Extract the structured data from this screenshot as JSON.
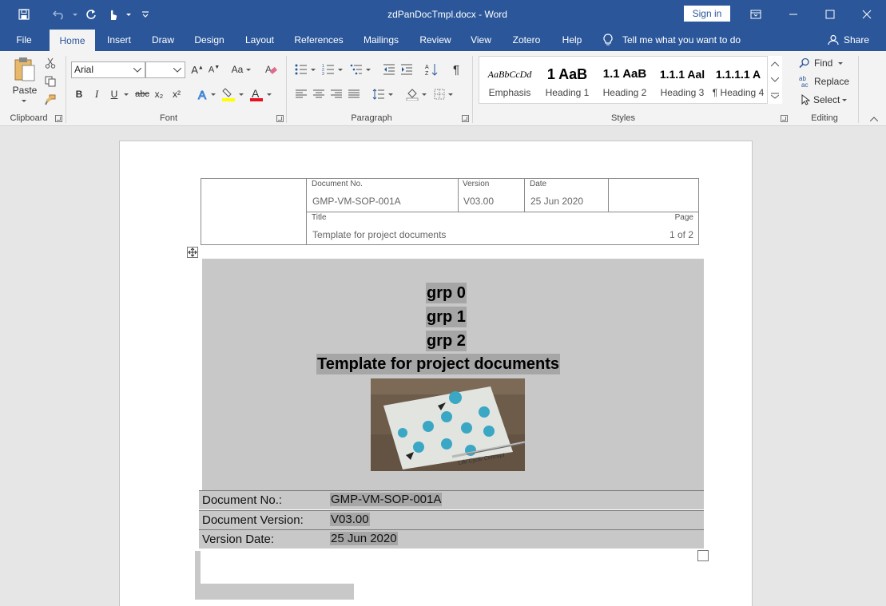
{
  "window": {
    "title": "zdPanDocTmpl.docx  -  Word",
    "sign_in": "Sign in"
  },
  "ribbon_tabs": [
    "File",
    "Home",
    "Insert",
    "Draw",
    "Design",
    "Layout",
    "References",
    "Mailings",
    "Review",
    "View",
    "Zotero",
    "Help"
  ],
  "tell_me": "Tell me what you want to do",
  "share": "Share",
  "clipboard": {
    "paste": "Paste",
    "label": "Clipboard"
  },
  "font": {
    "name": "Arial",
    "size": "",
    "label": "Font",
    "case_label": "Aa",
    "bold": "B",
    "italic": "I",
    "underline": "U",
    "strike": "abc",
    "sub": "x₂",
    "sup": "x²"
  },
  "paragraph": {
    "label": "Paragraph"
  },
  "styles": {
    "label": "Styles",
    "items": [
      {
        "sample": "AaBbCcDd",
        "name": "Emphasis"
      },
      {
        "sample": "1  AaB",
        "name": "Heading 1"
      },
      {
        "sample": "1.1  AaB",
        "name": "Heading 2"
      },
      {
        "sample": "1.1.1  Aal",
        "name": "Heading 3"
      },
      {
        "sample": "1.1.1.1  A",
        "name": "¶ Heading 4"
      }
    ]
  },
  "editing": {
    "label": "Editing",
    "find": "Find",
    "replace": "Replace",
    "select": "Select"
  },
  "header_table": {
    "doc_no_label": "Document No.",
    "doc_no": "GMP-VM-SOP-001A",
    "version_label": "Version",
    "version": "V03.00",
    "date_label": "Date",
    "date": "25 Jun 2020",
    "title_label": "Title",
    "title": "Template for project documents",
    "page_label": "Page",
    "page": "1 of 2"
  },
  "cover": {
    "grp0": "grp 0",
    "grp1": "grp 1",
    "grp2": "grp 2",
    "main_title": "Template for project documents",
    "photo_caption": "Life Cycle Concept"
  },
  "info_rows": [
    {
      "label": "Document No.:",
      "value": "GMP-VM-SOP-001A"
    },
    {
      "label": "Document Version:",
      "value": "V03.00"
    },
    {
      "label": "Version Date:",
      "value": "25 Jun 2020"
    }
  ]
}
